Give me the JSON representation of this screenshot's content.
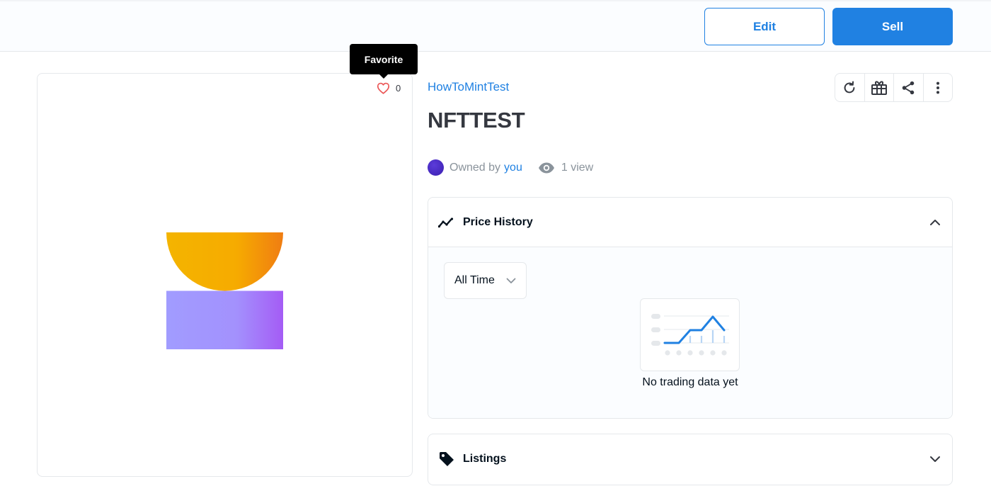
{
  "header": {
    "edit_label": "Edit",
    "sell_label": "Sell"
  },
  "media": {
    "tooltip": "Favorite",
    "favorite_count": "0"
  },
  "item": {
    "collection": "HowToMintTest",
    "title": "NFTTEST",
    "owned_by_prefix": "Owned by",
    "owner": "you",
    "views": "1 view"
  },
  "actions": {
    "icons": [
      "refresh-icon",
      "gift-icon",
      "share-icon",
      "more-vertical-icon"
    ]
  },
  "price_history": {
    "title": "Price History",
    "filter_value": "All Time",
    "empty_text": "No trading data yet"
  },
  "listings": {
    "title": "Listings"
  },
  "colors": {
    "accent": "#2081e2",
    "heart": "#eb5757",
    "art_top_from": "#f4b400",
    "art_top_to": "#f07d12",
    "art_bottom_from": "#a19cff",
    "art_bottom_to": "#a45cf5"
  }
}
